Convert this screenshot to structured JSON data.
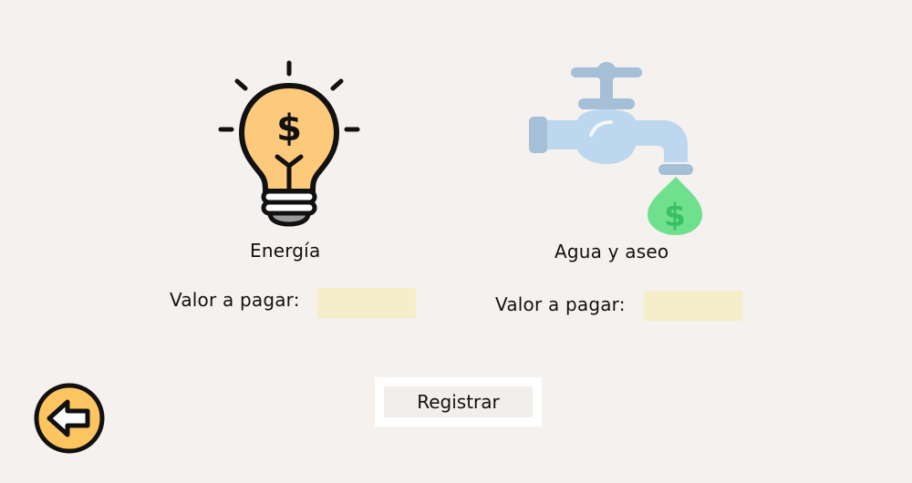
{
  "energy": {
    "title": "Energía",
    "value_label": "Valor a pagar:",
    "value": "",
    "icon": "lightbulb-dollar-icon"
  },
  "water": {
    "title": "Agua y aseo",
    "value_label": "Valor a pagar:",
    "value": "",
    "icon": "faucet-dollar-icon"
  },
  "actions": {
    "register_label": "Registrar",
    "back_icon": "arrow-left-icon"
  },
  "colors": {
    "background": "#f4f1ee",
    "input_fill": "#f6edca",
    "bulb_fill": "#fdc97a",
    "faucet_fill": "#bcd7ee",
    "faucet_dark": "#a4bfd6",
    "drop_fill": "#6fe08e",
    "back_fill": "#fcc560"
  }
}
